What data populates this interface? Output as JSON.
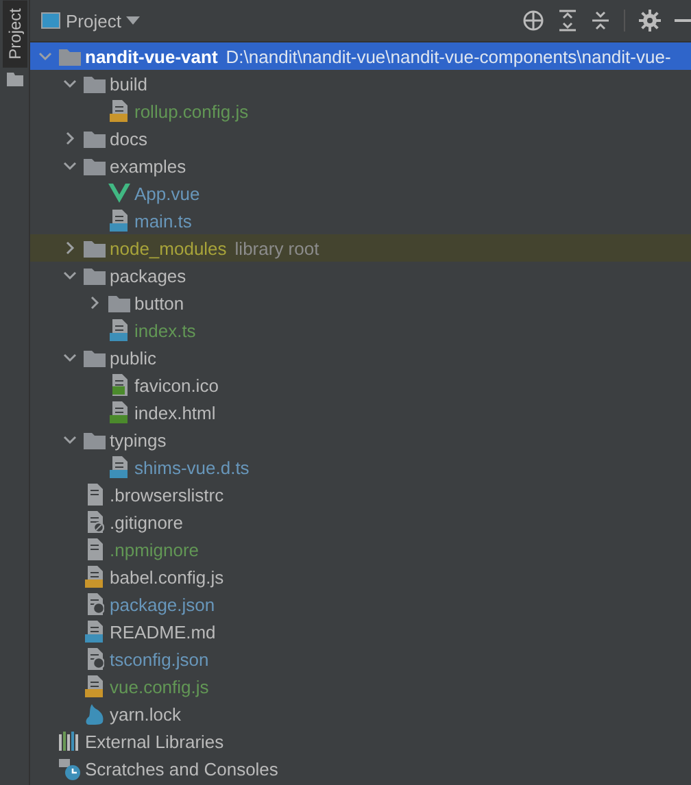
{
  "side_tab": {
    "label": "Project",
    "selected": true
  },
  "panel": {
    "title": "Project"
  },
  "tree": [
    {
      "name": "nandit-vue-vant",
      "hint": "D:\\nandit\\nandit-vue\\nandit-vue-components\\nandit-vue-",
      "kind": "folder",
      "expanded": true,
      "selected": true,
      "children": [
        {
          "name": "build",
          "kind": "folder",
          "color": "#bbbbbb",
          "expanded": true,
          "selected": false,
          "children": [
            {
              "name": "rollup.config.js",
              "kind": "js",
              "color": "#629755",
              "selected": false
            }
          ]
        },
        {
          "name": "docs",
          "kind": "folder",
          "color": "#bbbbbb",
          "expanded": false,
          "selected": false
        },
        {
          "name": "examples",
          "kind": "folder",
          "color": "#bbbbbb",
          "expanded": true,
          "selected": false,
          "children": [
            {
              "name": "App.vue",
              "kind": "vue",
              "color": "#6897bb",
              "selected": false
            },
            {
              "name": "main.ts",
              "kind": "ts",
              "color": "#6897bb",
              "selected": false
            }
          ]
        },
        {
          "name": "node_modules",
          "hint": "library root",
          "kind": "folder",
          "color": "#a8a43a",
          "excluded": true,
          "expanded": false,
          "selected": false
        },
        {
          "name": "packages",
          "kind": "folder",
          "color": "#bbbbbb",
          "expanded": true,
          "selected": false,
          "children": [
            {
              "name": "button",
              "kind": "folder",
              "color": "#bbbbbb",
              "expanded": false,
              "selected": false
            },
            {
              "name": "index.ts",
              "kind": "ts",
              "color": "#629755",
              "selected": false
            }
          ]
        },
        {
          "name": "public",
          "kind": "folder",
          "color": "#bbbbbb",
          "expanded": true,
          "selected": false,
          "children": [
            {
              "name": "favicon.ico",
              "kind": "image",
              "color": "#bbbbbb",
              "selected": false
            },
            {
              "name": "index.html",
              "kind": "html",
              "color": "#bbbbbb",
              "selected": false
            }
          ]
        },
        {
          "name": "typings",
          "kind": "folder",
          "color": "#bbbbbb",
          "expanded": true,
          "selected": false,
          "children": [
            {
              "name": "shims-vue.d.ts",
              "kind": "ts",
              "color": "#6897bb",
              "selected": false
            }
          ]
        },
        {
          "name": ".browserslistrc",
          "kind": "text",
          "color": "#bbbbbb",
          "selected": false
        },
        {
          "name": ".gitignore",
          "kind": "ignore",
          "color": "#bbbbbb",
          "selected": false
        },
        {
          "name": ".npmignore",
          "kind": "text",
          "color": "#629755",
          "selected": false
        },
        {
          "name": "babel.config.js",
          "kind": "js",
          "color": "#bbbbbb",
          "selected": false
        },
        {
          "name": "package.json",
          "kind": "json",
          "color": "#6897bb",
          "selected": false
        },
        {
          "name": "README.md",
          "kind": "md",
          "color": "#bbbbbb",
          "selected": false
        },
        {
          "name": "tsconfig.json",
          "kind": "json",
          "color": "#6897bb",
          "selected": false
        },
        {
          "name": "vue.config.js",
          "kind": "js",
          "color": "#629755",
          "selected": false
        },
        {
          "name": "yarn.lock",
          "kind": "yarn",
          "color": "#bbbbbb",
          "selected": false
        }
      ]
    },
    {
      "name": "External Libraries",
      "kind": "libraries",
      "color": "#bbbbbb",
      "selected": false
    },
    {
      "name": "Scratches and Consoles",
      "kind": "scratches",
      "color": "#bbbbbb",
      "selected": false
    }
  ]
}
